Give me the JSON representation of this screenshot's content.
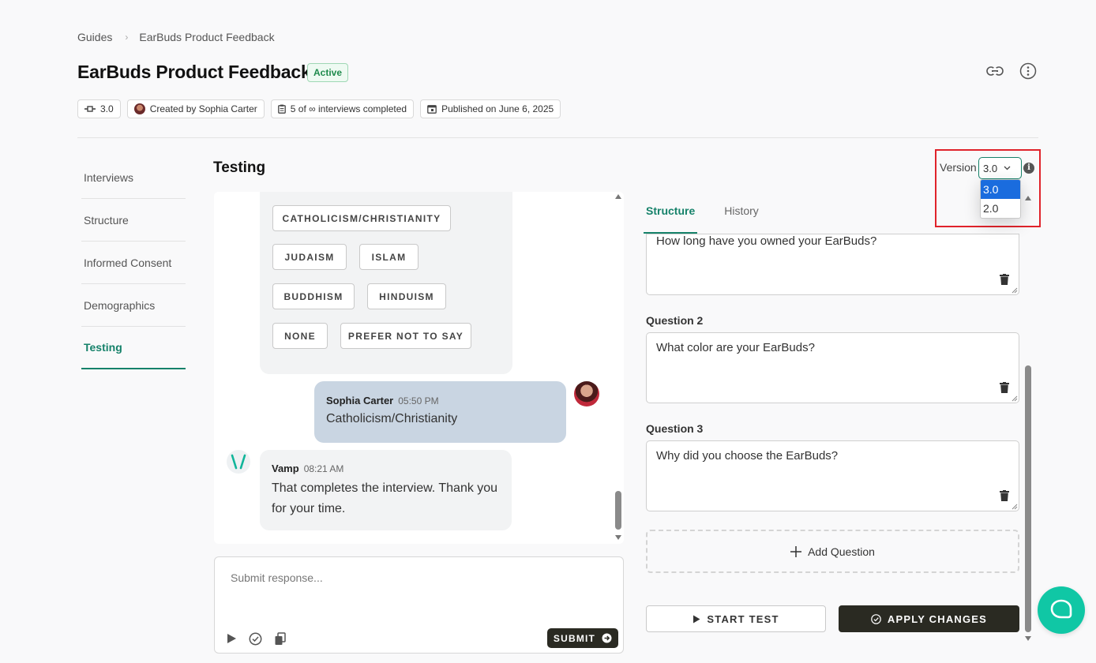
{
  "breadcrumb": {
    "root": "Guides",
    "separator": "›",
    "current": "EarBuds Product Feedback"
  },
  "header": {
    "title": "EarBuds Product Feedback",
    "status": "Active",
    "meta": {
      "version": "3.0",
      "created_by": "Created by Sophia Carter",
      "interviews": "5 of ∞ interviews completed",
      "published": "Published on June 6, 2025"
    }
  },
  "nav": {
    "items": [
      {
        "label": "Interviews"
      },
      {
        "label": "Structure"
      },
      {
        "label": "Informed Consent"
      },
      {
        "label": "Demographics"
      },
      {
        "label": "Testing"
      }
    ],
    "active": "Testing"
  },
  "section": {
    "title": "Testing"
  },
  "chat": {
    "options": [
      "CATHOLICISM/CHRISTIANITY",
      "JUDAISM",
      "ISLAM",
      "BUDDHISM",
      "HINDUISM",
      "NONE",
      "PREFER NOT TO SAY"
    ],
    "messages": [
      {
        "sender": "Sophia Carter",
        "time": "05:50 PM",
        "text": "Catholicism/Christianity"
      },
      {
        "sender": "Vamp",
        "time": "08:21 AM",
        "text": "That completes the interview. Thank you for your time."
      }
    ],
    "response_placeholder": "Submit response...",
    "submit_label": "SUBMIT"
  },
  "right_panel": {
    "tabs": [
      "Structure",
      "History"
    ],
    "active_tab": "Structure",
    "questions": [
      {
        "label": "",
        "text": "How long have you owned your EarBuds?"
      },
      {
        "label": "Question 2",
        "text": "What color are your EarBuds?"
      },
      {
        "label": "Question 3",
        "text": "Why did you choose the EarBuds?"
      }
    ],
    "add_question_label": "Add Question",
    "start_test_label": "START TEST",
    "apply_changes_label": "APPLY CHANGES"
  },
  "version": {
    "label": "Version",
    "selected": "3.0",
    "options": [
      "3.0",
      "2.0"
    ],
    "info_glyph": "i"
  },
  "colors": {
    "accent": "#16826a",
    "dark_button": "#2a2a22",
    "help": "#10c7a5",
    "highlight": "#e0232b"
  }
}
